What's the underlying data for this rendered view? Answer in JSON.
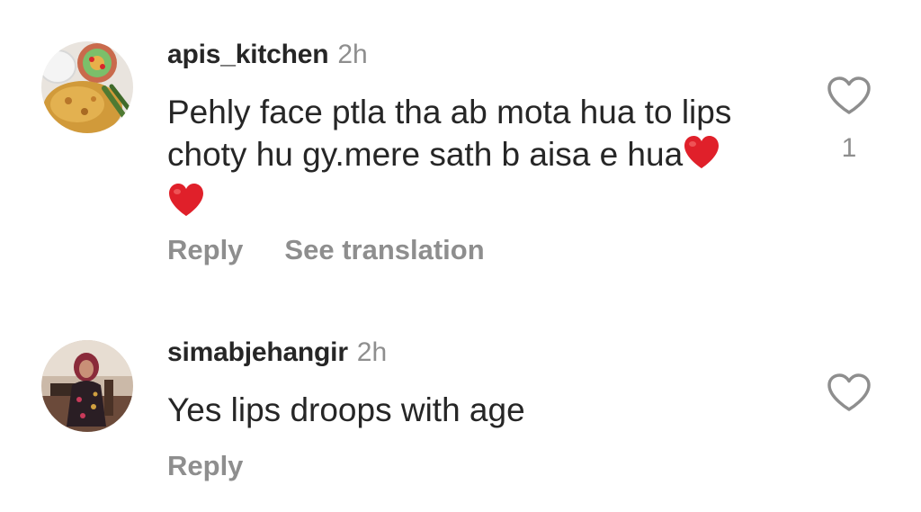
{
  "comments": [
    {
      "username": "apis_kitchen",
      "time": "2h",
      "text": "Pehly face ptla tha ab mota hua to lips choty hu gy.mere sath b aisa e hua",
      "emojis": [
        "red-heart",
        "red-heart"
      ],
      "actions": {
        "reply": "Reply",
        "translate": "See translation"
      },
      "likes": "1",
      "avatar": "food-plate-avatar"
    },
    {
      "username": "simabjehangir",
      "time": "2h",
      "text": "Yes lips droops with age",
      "actions": {
        "reply": "Reply"
      },
      "avatar": "profile-photo-avatar"
    }
  ],
  "colors": {
    "text": "#262626",
    "muted": "#8e8e8e",
    "heart": "#e0202a"
  }
}
